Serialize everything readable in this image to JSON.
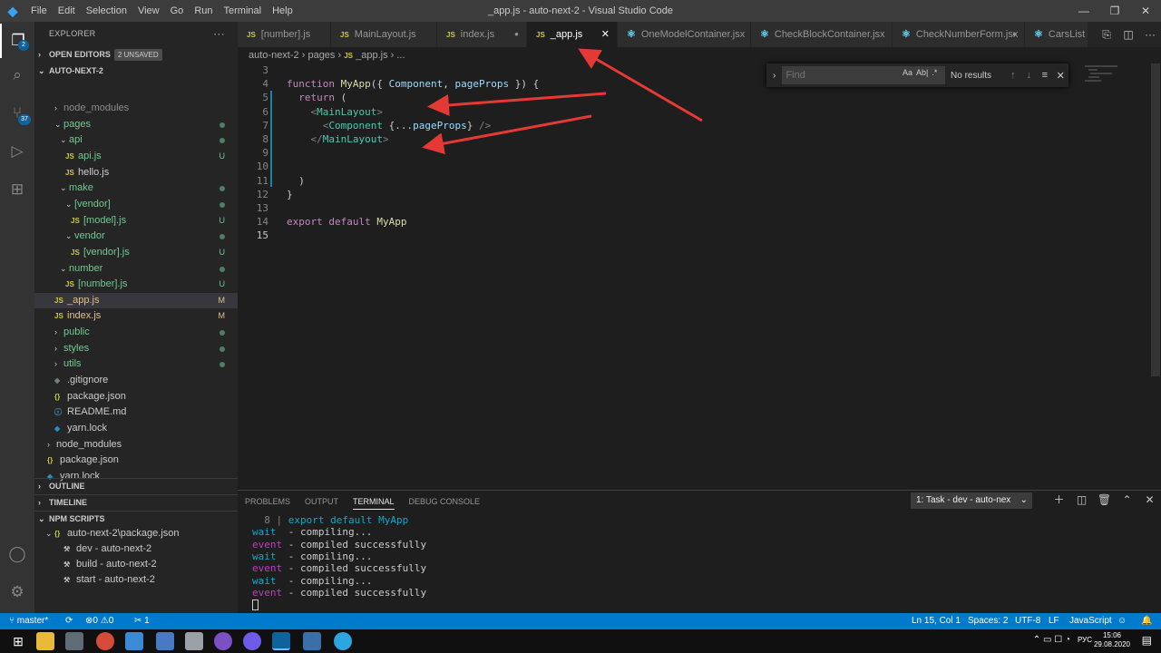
{
  "titlebar": {
    "menu": [
      "File",
      "Edit",
      "Selection",
      "View",
      "Go",
      "Run",
      "Terminal",
      "Help"
    ],
    "title": "_app.js - auto-next-2 - Visual Studio Code"
  },
  "activity": {
    "explorer_badge": "2",
    "scm_badge": "37"
  },
  "sidebar": {
    "title": "EXPLORER",
    "open_editors": "OPEN EDITORS",
    "unsaved_badge": "2 UNSAVED",
    "workspace": "AUTO-NEXT-2",
    "tree": [
      {
        "label": "node_modules",
        "kind": "folder",
        "open": false
      },
      {
        "label": "pages",
        "kind": "folder",
        "open": true
      },
      {
        "label": "api",
        "kind": "folder",
        "open": true
      },
      {
        "label": "api.js",
        "kind": "js",
        "status": "U"
      },
      {
        "label": "hello.js",
        "kind": "js",
        "status": ""
      },
      {
        "label": "make",
        "kind": "folder",
        "open": true
      },
      {
        "label": "[vendor]",
        "kind": "folder",
        "open": true
      },
      {
        "label": "[model].js",
        "kind": "js",
        "status": "U"
      },
      {
        "label": "vendor",
        "kind": "folder",
        "open": true
      },
      {
        "label": "[vendor].js",
        "kind": "js",
        "status": "U"
      },
      {
        "label": "number",
        "kind": "folder",
        "open": true
      },
      {
        "label": "[number].js",
        "kind": "js",
        "status": "U"
      },
      {
        "label": "_app.js",
        "kind": "js",
        "status": "M"
      },
      {
        "label": "index.js",
        "kind": "js",
        "status": "M"
      },
      {
        "label": "public",
        "kind": "folder",
        "open": false
      },
      {
        "label": "styles",
        "kind": "folder",
        "open": false
      },
      {
        "label": "utils",
        "kind": "folder",
        "open": false
      },
      {
        "label": ".gitignore",
        "kind": "file",
        "status": ""
      },
      {
        "label": "package.json",
        "kind": "json",
        "status": ""
      },
      {
        "label": "README.md",
        "kind": "info",
        "status": ""
      },
      {
        "label": "yarn.lock",
        "kind": "yarn",
        "status": ""
      },
      {
        "label": "node_modules",
        "kind": "folder",
        "open": false
      },
      {
        "label": "package.json",
        "kind": "json",
        "status": ""
      },
      {
        "label": "yarn.lock",
        "kind": "yarn",
        "status": ""
      }
    ],
    "outline": "OUTLINE",
    "timeline": "TIMELINE",
    "npm_scripts": "NPM SCRIPTS",
    "npm_package": "auto-next-2\\package.json",
    "npm_items": [
      "dev - auto-next-2",
      "build - auto-next-2",
      "start - auto-next-2"
    ]
  },
  "tabs": [
    {
      "label": "[number].js",
      "icon": "JS",
      "active": false,
      "dirty": false
    },
    {
      "label": "MainLayout.js",
      "icon": "JS",
      "active": false,
      "dirty": false
    },
    {
      "label": "index.js",
      "icon": "JS",
      "active": false,
      "dirty": true
    },
    {
      "label": "_app.js",
      "icon": "JS",
      "active": true,
      "dirty": false
    },
    {
      "label": "OneModelContainer.jsx",
      "icon": "react",
      "active": false,
      "dirty": false
    },
    {
      "label": "CheckBlockContainer.jsx",
      "icon": "react",
      "active": false,
      "dirty": false
    },
    {
      "label": "CheckNumberForm.jsx",
      "icon": "react",
      "active": false,
      "dirty": true
    },
    {
      "label": "CarsList",
      "icon": "react",
      "active": false,
      "dirty": false
    }
  ],
  "breadcrumb": {
    "parts": [
      "auto-next-2",
      "pages",
      "_app.js",
      "..."
    ],
    "file_icon": "JS"
  },
  "editor": {
    "lines": [
      {
        "n": "3",
        "code": ""
      },
      {
        "n": "4",
        "code": "function MyApp({ Component, pageProps }) {"
      },
      {
        "n": "5",
        "code": "  return ("
      },
      {
        "n": "6",
        "code": "    <MainLayout>"
      },
      {
        "n": "7",
        "code": "      <Component {...pageProps} />"
      },
      {
        "n": "8",
        "code": "    </MainLayout>"
      },
      {
        "n": "9",
        "code": ""
      },
      {
        "n": "10",
        "code": ""
      },
      {
        "n": "11",
        "code": "  )"
      },
      {
        "n": "12",
        "code": "}"
      },
      {
        "n": "13",
        "code": ""
      },
      {
        "n": "14",
        "code": "export default MyApp"
      },
      {
        "n": "15",
        "code": ""
      }
    ]
  },
  "find": {
    "placeholder": "Find",
    "result": "No results",
    "opt_case": "Aa",
    "opt_word": "Ab|",
    "opt_regex": ".*"
  },
  "panel": {
    "tabs": [
      "PROBLEMS",
      "OUTPUT",
      "TERMINAL",
      "DEBUG CONSOLE"
    ],
    "active_tab": "TERMINAL",
    "task_select": "1: Task - dev - auto-nex",
    "terminal": [
      {
        "prefix": "  8 | ",
        "type": "code",
        "text": "export default MyApp"
      },
      {
        "prefix": "wait ",
        "type": "wait",
        "text": " - compiling..."
      },
      {
        "prefix": "event",
        "type": "event",
        "text": " - compiled successfully"
      },
      {
        "prefix": "wait ",
        "type": "wait",
        "text": " - compiling..."
      },
      {
        "prefix": "event",
        "type": "event",
        "text": " - compiled successfully"
      },
      {
        "prefix": "wait ",
        "type": "wait",
        "text": " - compiling..."
      },
      {
        "prefix": "event",
        "type": "event",
        "text": " - compiled successfully"
      }
    ]
  },
  "statusbar": {
    "branch": "master*",
    "problems": "0",
    "warnings": "0",
    "ports": "1",
    "position": "Ln 15, Col 1",
    "spaces": "Spaces: 2",
    "encoding": "UTF-8",
    "eol": "LF",
    "language": "JavaScript"
  },
  "taskbar": {
    "time": "15:06",
    "date": "29.08.2020",
    "lang": "РУС"
  },
  "colors": {
    "accent": "#007acc",
    "arrow": "#e53935"
  }
}
